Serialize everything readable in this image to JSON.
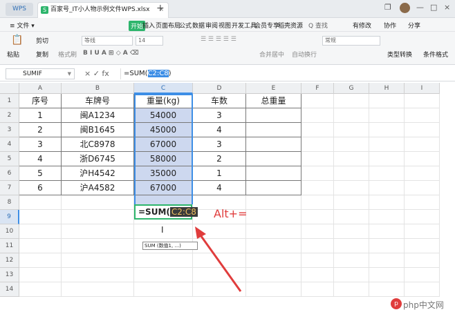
{
  "titlebar": {
    "wps_label": "WPS",
    "doc_tab": "百家号_IT小人物示例文件WPS.xlsx",
    "close": "×",
    "new_tab": "+",
    "win_restore": "❐",
    "win_min": "—",
    "win_max": "□",
    "win_close": "×"
  },
  "menu": {
    "file": "≡ 文件 ▾",
    "kaishi": "开始",
    "items": [
      "插入",
      "页面布局",
      "公式",
      "数据",
      "审阅",
      "视图",
      "开发工具",
      "会员专享",
      "稻壳资源"
    ],
    "search": "Q 查找",
    "edited": "有修改",
    "collab": "协作",
    "share": "分享"
  },
  "toolbar": {
    "cut": "剪切",
    "paste": "粘贴",
    "copy": "复制",
    "format_painter": "格式刷",
    "font": "等线",
    "size": "14",
    "merge": "合并居中",
    "wrap": "自动换行",
    "number_format": "常规",
    "type_convert": "类型转换",
    "cond_format": "条件格式"
  },
  "formula_bar": {
    "name_box": "SUMIF",
    "fx": "× ✓ fx",
    "prefix": "=SUM(",
    "ref": "C2:C8",
    "suffix": ")"
  },
  "columns": [
    "A",
    "B",
    "C",
    "D",
    "E",
    "F",
    "G",
    "H",
    "I"
  ],
  "rows": [
    "1",
    "2",
    "3",
    "4",
    "5",
    "6",
    "7",
    "8",
    "9",
    "10",
    "11",
    "12",
    "13",
    "14"
  ],
  "headers": [
    "序号",
    "车牌号",
    "重量(kg)",
    "车数",
    "总重量"
  ],
  "table": [
    [
      "1",
      "闽A1234",
      "54000",
      "3",
      ""
    ],
    [
      "2",
      "闽B1645",
      "45000",
      "4",
      ""
    ],
    [
      "3",
      "北C8978",
      "67000",
      "3",
      ""
    ],
    [
      "4",
      "浙D6745",
      "58000",
      "2",
      ""
    ],
    [
      "5",
      "沪H4542",
      "35000",
      "1",
      ""
    ],
    [
      "6",
      "沪A4582",
      "67000",
      "4",
      ""
    ]
  ],
  "edit_cell": {
    "prefix": "=SUM(",
    "ref": "C2:C8"
  },
  "tooltip": "SUM (数值1, ...)",
  "annotation": "Alt+=",
  "watermark": "php中文网"
}
